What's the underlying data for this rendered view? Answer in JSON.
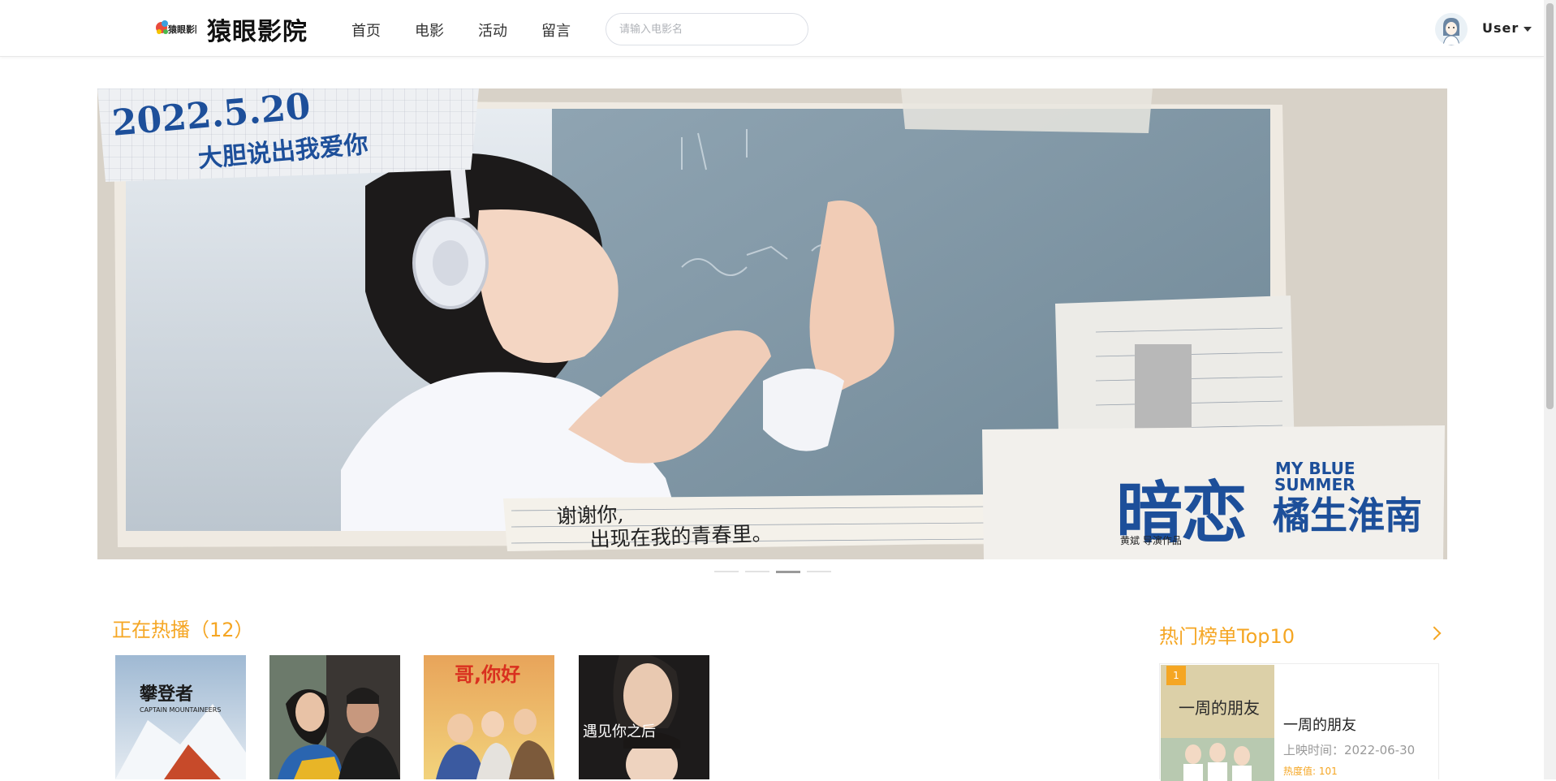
{
  "header": {
    "brand": "猿眼影院",
    "logo_text": "猿眼影院",
    "nav": [
      "首页",
      "电影",
      "活动",
      "留言"
    ],
    "search_placeholder": "请输入电影名",
    "user": "User"
  },
  "banner": {
    "date": "2022.5.20",
    "tagline": "大胆说出我爱你",
    "handwriting_line1": "谢谢你,",
    "handwriting_line2": "出现在我的青春里。",
    "title": "暗恋",
    "title_en_line1": "MY BLUE",
    "title_en_line2": "SUMMER",
    "subtitle": "橘生淮南",
    "director": "黄斌 导演作品",
    "slides": 4,
    "active_slide": 3
  },
  "now_playing": {
    "title": "正在热播（12）",
    "posters": [
      {
        "title": "攀登者",
        "en": "CAPTAIN MOUNTAINEERS"
      },
      {
        "title": "",
        "en": ""
      },
      {
        "title": "哥,你好",
        "en": ""
      },
      {
        "title": "遇见你之后",
        "en": ""
      }
    ]
  },
  "top10": {
    "title": "热门榜单Top10",
    "items": [
      {
        "rank": "1",
        "name": "一周的朋友",
        "release_date": "上映时间：2022-06-30",
        "heat": "热度值: 101"
      }
    ]
  },
  "colors": {
    "accent": "#f5a623",
    "banner_blue": "#1d4f9a"
  }
}
